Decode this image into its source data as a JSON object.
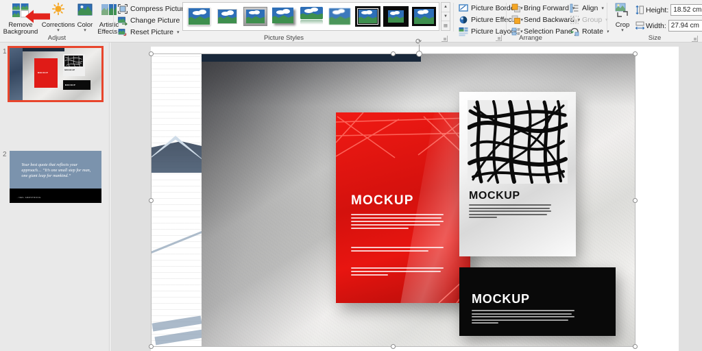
{
  "ribbon": {
    "groups": [
      {
        "name": "Adjust",
        "label": "Adjust"
      },
      {
        "name": "Picture Styles",
        "label": "Picture Styles"
      },
      {
        "name": "Arrange",
        "label": "Arrange"
      },
      {
        "name": "Size",
        "label": "Size"
      }
    ],
    "adjust": {
      "remove_background": "Remove\nBackground",
      "remove_background_line1": "Remove",
      "remove_background_line2": "Background",
      "corrections": "Corrections",
      "color": "Color",
      "artistic_effects_line1": "Artistic",
      "artistic_effects_line2": "Effects",
      "compress_pictures": "Compress Pictures",
      "change_picture": "Change Picture",
      "reset_picture": "Reset Picture"
    },
    "picture_styles": {
      "label": "Picture Styles",
      "thumbnails": [
        {
          "name": "simple-frame-white",
          "style": "simple-frame-white"
        },
        {
          "name": "beveled-matte-white",
          "style": "beveled-matte-white"
        },
        {
          "name": "metal-frame",
          "style": "metal-frame"
        },
        {
          "name": "drop-shadow-rectangle",
          "style": "drop-shadow-rectangle"
        },
        {
          "name": "reflected-rounded-rectangle",
          "style": "reflected-rounded"
        },
        {
          "name": "soft-edge-rectangle",
          "style": "soft-edge"
        },
        {
          "name": "double-frame-black",
          "style": "double-frame-black"
        },
        {
          "name": "thick-matte-black",
          "style": "thick-matte-black"
        },
        {
          "name": "simple-frame-black",
          "style": "simple-frame-black"
        }
      ],
      "scroll_up": "▲",
      "scroll_down": "▼",
      "more": "▤"
    },
    "arrange": {
      "picture_border": "Picture Border",
      "picture_effects": "Picture Effects",
      "picture_layout": "Picture Layout",
      "bring_forward": "Bring Forward",
      "send_backward": "Send Backward",
      "selection_pane": "Selection Pane",
      "align": "Align",
      "group": "Group",
      "rotate": "Rotate"
    },
    "size": {
      "crop": "Crop",
      "height_label": "Height:",
      "height_value": "18.52 cm",
      "width_label": "Width:",
      "width_value": "27.94 cm"
    }
  },
  "slide_panel": {
    "slides": [
      {
        "number": "1",
        "selected": true
      },
      {
        "number": "2",
        "selected": false
      }
    ],
    "slide1_thumb": {
      "red_label": "MOCKUP",
      "white_label": "MOCKUP",
      "black_label": "MOCKUP"
    },
    "slide2_thumb": {
      "quote": "Your best quote that reflects your approach… “It’s one small step for man, one giant leap for mankind.”",
      "attribution": "- NEIL ARMSTRONG"
    }
  },
  "canvas": {
    "red_poster": {
      "title": "MOCKUP"
    },
    "white_poster": {
      "title": "MOCKUP"
    },
    "black_poster": {
      "title": "MOCKUP"
    }
  },
  "colors": {
    "accent_red": "#e01b17",
    "ribbon_bg": "#f1f1f1",
    "selection_orange": "#e8452c",
    "panel_bg": "#e9e9e9",
    "canvas_bg": "#e0e0e0"
  }
}
